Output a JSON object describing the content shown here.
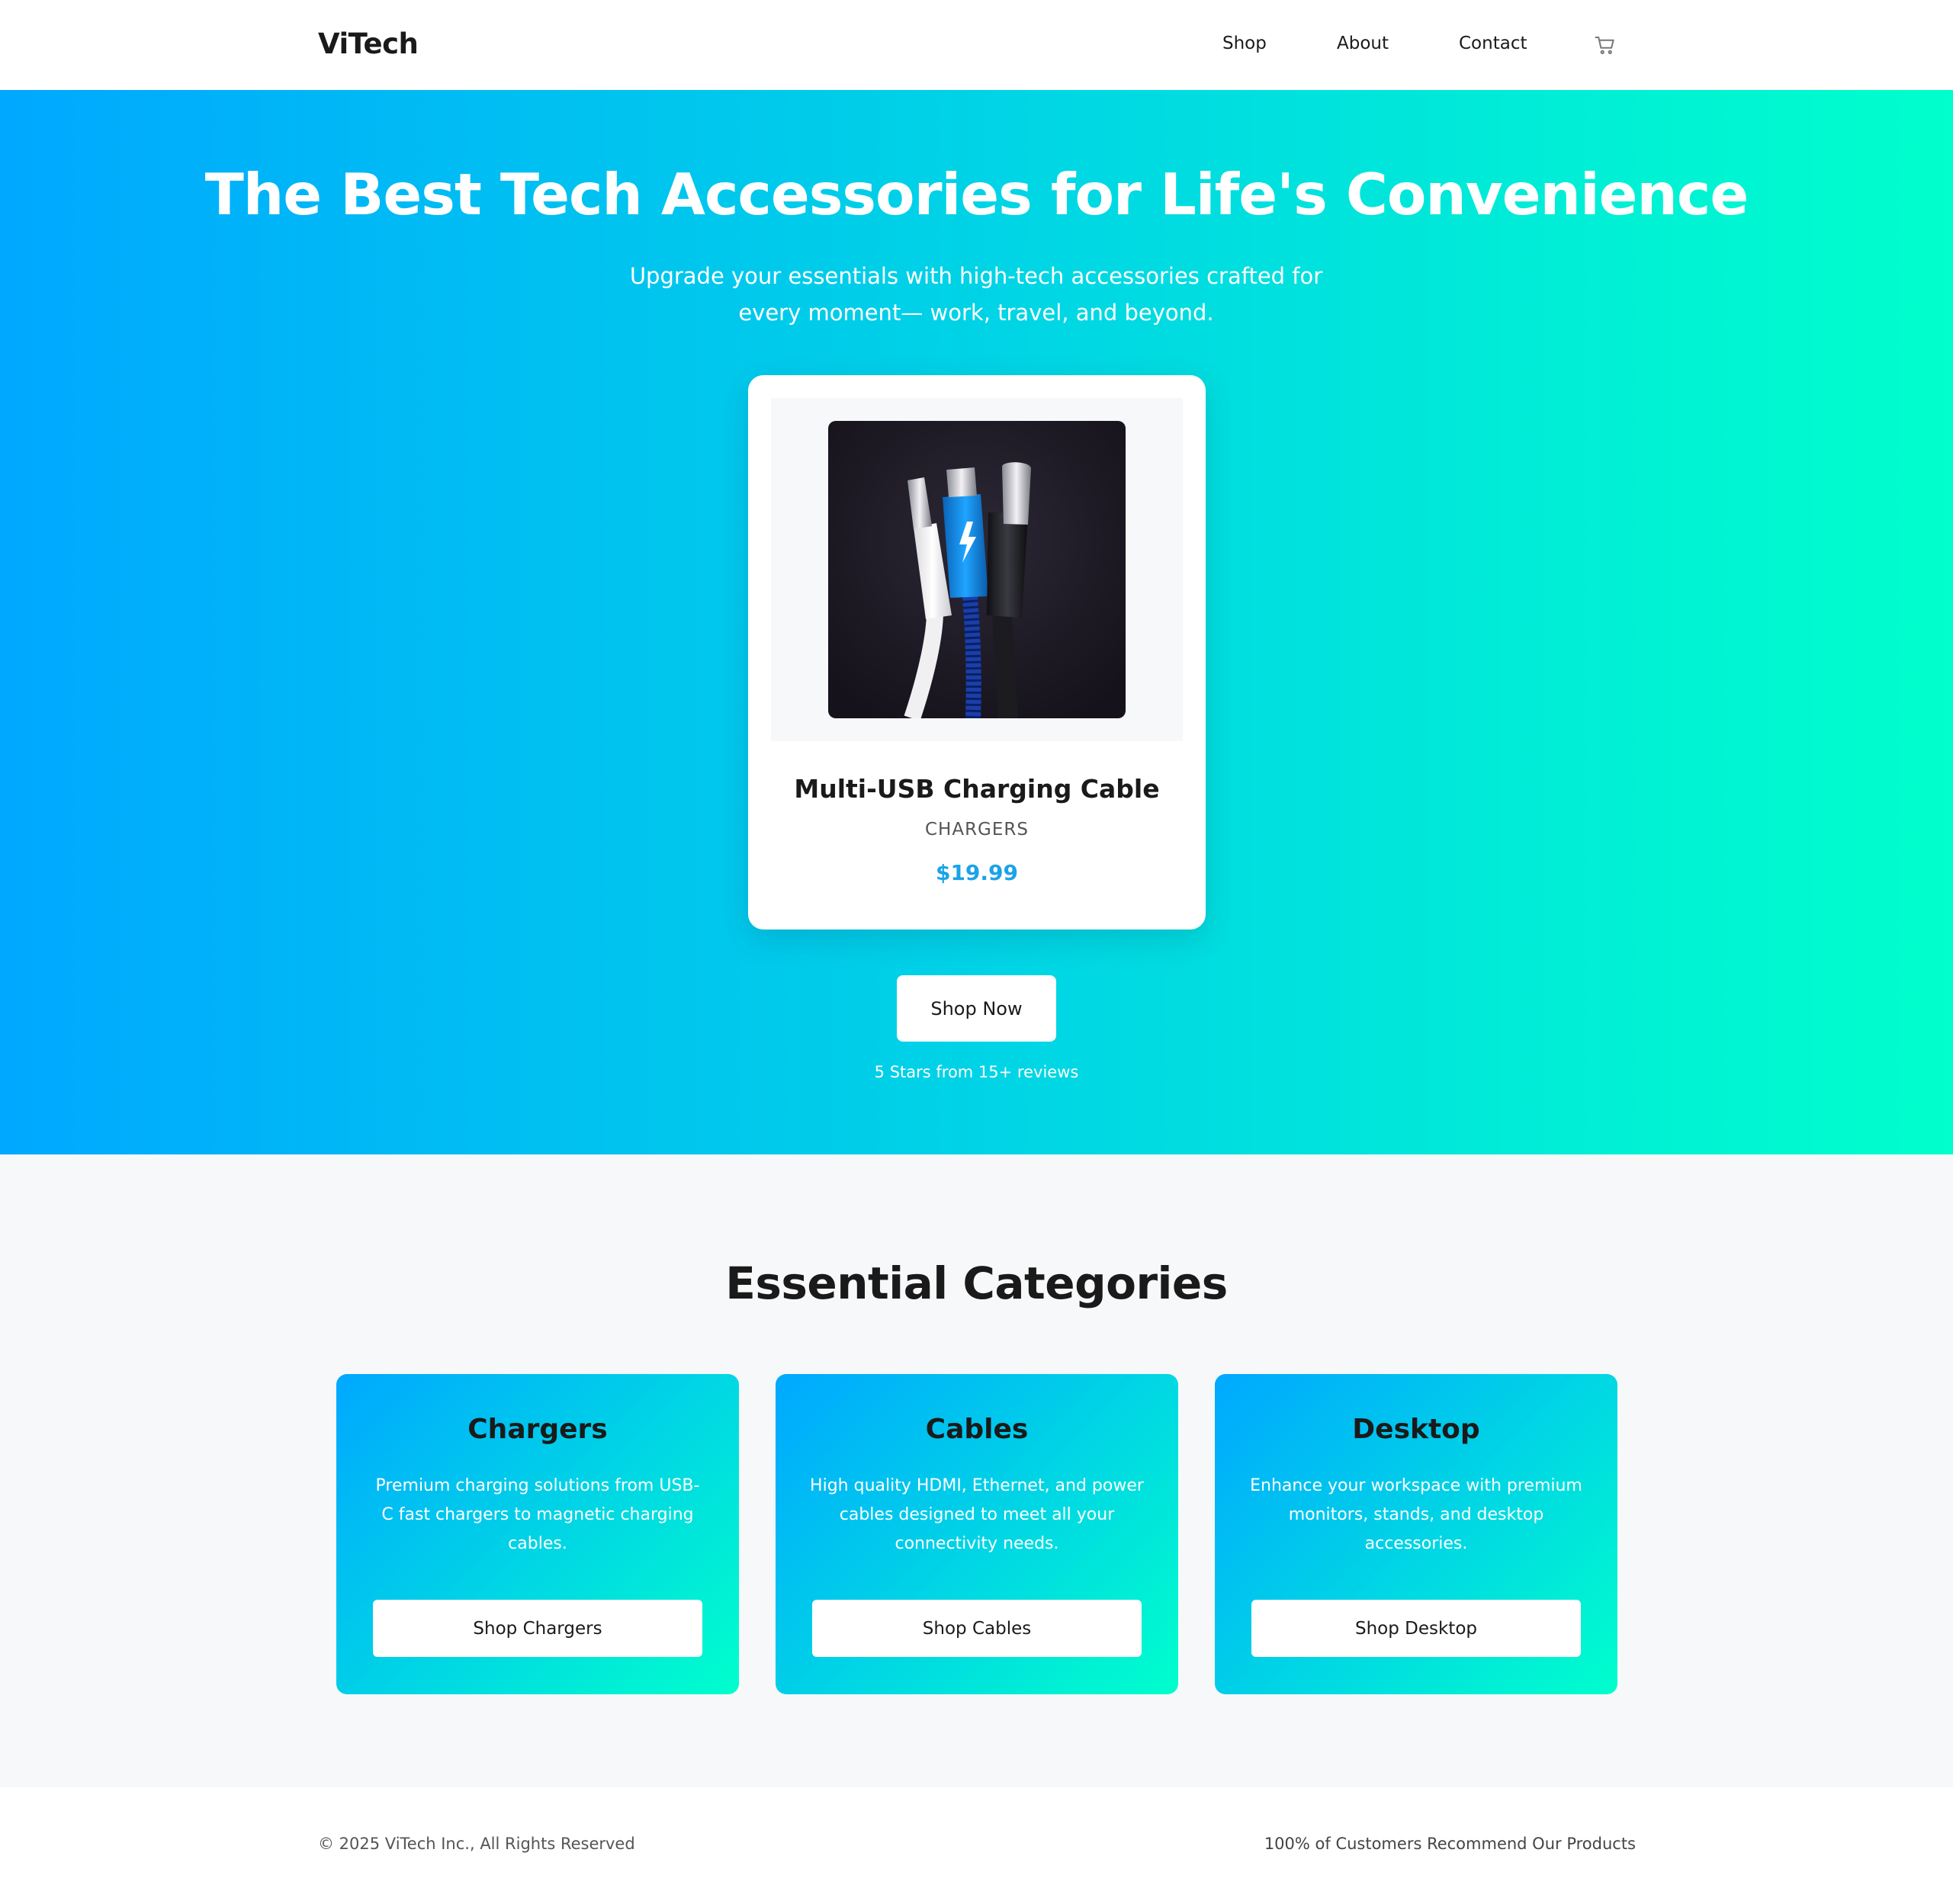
{
  "nav": {
    "logo": "ViTech",
    "links": [
      "Shop",
      "About",
      "Contact"
    ],
    "cart_icon": "cart-icon"
  },
  "hero": {
    "title": "The Best Tech Accessories for Life's Convenience",
    "subtitle": "Upgrade your essentials with high-tech accessories crafted for every moment— work, travel, and beyond.",
    "product": {
      "name": "Multi-USB Charging Cable",
      "category": "CHARGERS",
      "price": "$19.99"
    },
    "cta": "Shop Now",
    "reviews": "5 Stars from 15+ reviews"
  },
  "categories": {
    "heading": "Essential Categories",
    "items": [
      {
        "title": "Chargers",
        "description": "Premium charging solutions from USB-C fast chargers to magnetic charging cables.",
        "button": "Shop Chargers"
      },
      {
        "title": "Cables",
        "description": "High quality HDMI, Ethernet, and power cables designed to meet all your connectivity needs.",
        "button": "Shop Cables"
      },
      {
        "title": "Desktop",
        "description": "Enhance your workspace with premium monitors, stands, and desktop accessories.",
        "button": "Shop Desktop"
      }
    ]
  },
  "footer": {
    "copyright": "© 2025 ViTech Inc., All Rights Reserved",
    "recommend": "100% of Customers Recommend Our Products"
  },
  "colors": {
    "gradient_start": "#00a8ff",
    "gradient_end": "#00ffcc",
    "price": "#1aa3e8"
  }
}
